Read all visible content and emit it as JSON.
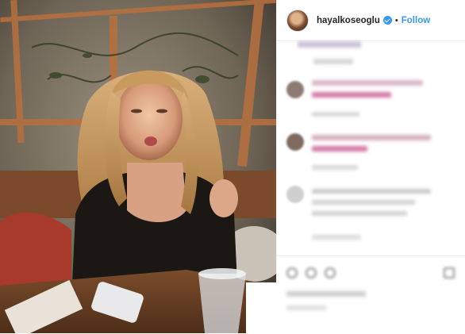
{
  "post": {
    "username": "hayalkoseoglu",
    "separator": "•",
    "follow_label": "Follow",
    "verified_icon": "verified-badge-icon",
    "colors": {
      "link": "#3897f0",
      "text": "#262626",
      "border": "#efefef"
    }
  }
}
